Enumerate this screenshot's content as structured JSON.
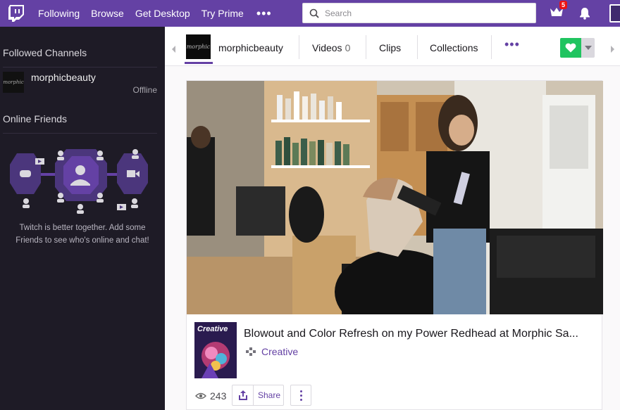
{
  "colors": {
    "brand_purple": "#6441a4",
    "sidebar_bg": "#1e1b26",
    "follow_green": "#20c460",
    "notification_red": "#ec1313"
  },
  "topnav": {
    "logo_icon": "twitch-logo-icon",
    "links": [
      "Following",
      "Browse",
      "Get Desktop",
      "Try Prime"
    ],
    "more_label": "•••",
    "search_placeholder": "Search",
    "prime_badge_count": "5",
    "icons": [
      "search-icon",
      "crown-icon",
      "bell-icon"
    ]
  },
  "sidebar": {
    "followed_title": "Followed Channels",
    "channels": [
      {
        "name": "morphicbeauty",
        "status": "Offline",
        "thumb_text": "morphic"
      }
    ],
    "friends_title": "Online Friends",
    "friends_message_line1": "Twitch is better together. Add some",
    "friends_message_line2": "Friends to see who's online and chat!"
  },
  "channel": {
    "logo_text": "morphic",
    "name": "morphicbeauty",
    "tabs": [
      {
        "label": "Videos",
        "count": "0"
      },
      {
        "label": "Clips"
      },
      {
        "label": "Collections"
      }
    ],
    "more_label": "•••"
  },
  "video": {
    "title": "Blowout and Color Refresh on my Power Redhead at Morphic Sa...",
    "game": "Creative",
    "game_art_text": "Creative",
    "views": "243",
    "share_label": "Share"
  }
}
